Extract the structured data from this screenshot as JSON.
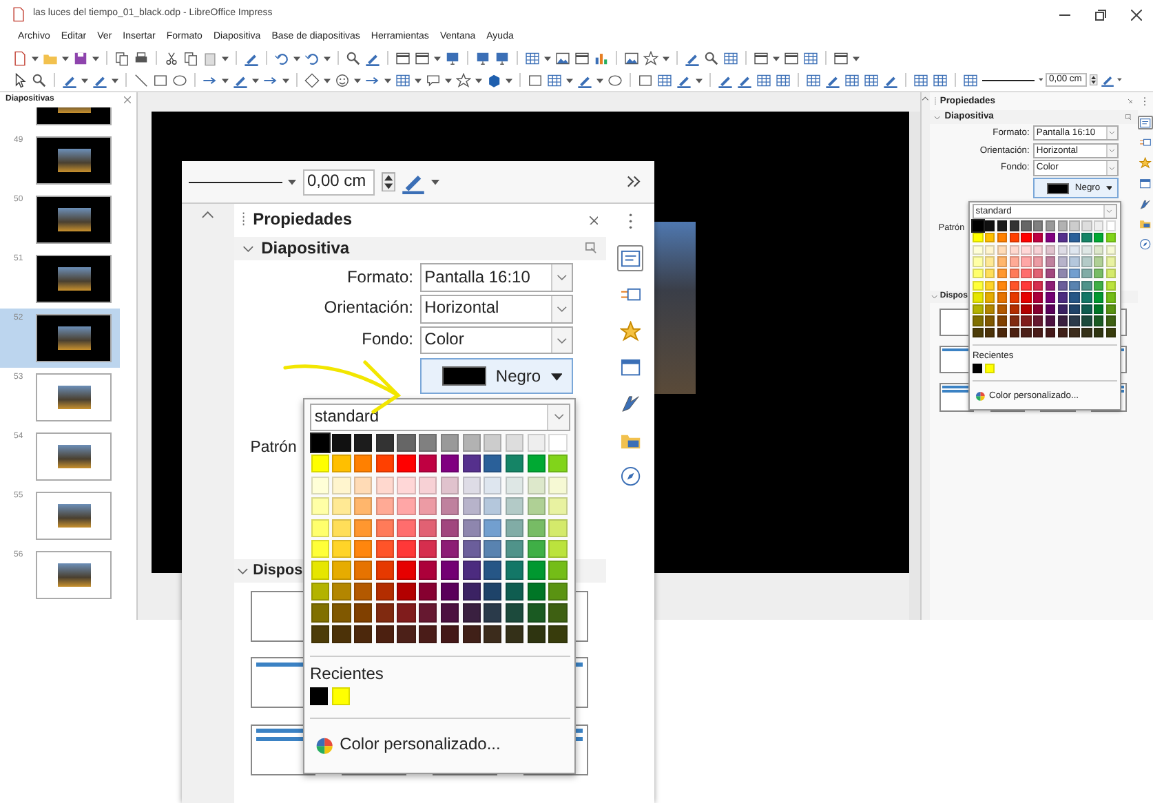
{
  "window": {
    "title": "las luces del tiempo_01_black.odp - LibreOffice Impress"
  },
  "menu": [
    "Archivo",
    "Editar",
    "Ver",
    "Insertar",
    "Formato",
    "Diapositiva",
    "Base de diapositivas",
    "Herramientas",
    "Ventana",
    "Ayuda"
  ],
  "toolbar": {
    "line_width": "0,00 cm"
  },
  "slides_pane": {
    "title": "Diapositivas",
    "slides": [
      {
        "color": "#000000",
        "selected": false
      },
      {
        "number": "49",
        "color": "#000000",
        "selected": false
      },
      {
        "number": "50",
        "color": "#000000",
        "selected": false
      },
      {
        "number": "51",
        "color": "#000000",
        "selected": false
      },
      {
        "number": "52",
        "color": "#000000",
        "selected": true
      },
      {
        "number": "53",
        "color": "#ffffff",
        "selected": false
      },
      {
        "number": "54",
        "color": "#ffffff",
        "selected": false
      },
      {
        "number": "55",
        "color": "#ffffff",
        "selected": false
      },
      {
        "number": "56",
        "color": "#ffffff",
        "selected": false
      }
    ]
  },
  "palette": [
    {
      "swatches": [
        {
          "color": "#000000",
          "selected": true
        },
        {
          "color": "#111111",
          "selected": false
        },
        {
          "color": "#1c1c1c",
          "selected": false
        },
        {
          "color": "#333333",
          "selected": false
        },
        {
          "color": "#666666",
          "selected": false
        },
        {
          "color": "#808080",
          "selected": false
        },
        {
          "color": "#999999",
          "selected": false
        },
        {
          "color": "#b2b2b2",
          "selected": false
        },
        {
          "color": "#cccccc",
          "selected": false
        },
        {
          "color": "#dddddd",
          "selected": false
        },
        {
          "color": "#eeeeee",
          "selected": false
        },
        {
          "color": "#ffffff",
          "selected": false
        }
      ]
    },
    {
      "swatches": [
        {
          "color": "#ffff00",
          "selected": false
        },
        {
          "color": "#ffbf00",
          "selected": false
        },
        {
          "color": "#ff8000",
          "selected": false
        },
        {
          "color": "#ff4000",
          "selected": false
        },
        {
          "color": "#ff0000",
          "selected": false
        },
        {
          "color": "#bf0041",
          "selected": false
        },
        {
          "color": "#800080",
          "selected": false
        },
        {
          "color": "#55308d",
          "selected": false
        },
        {
          "color": "#2a6099",
          "selected": false
        },
        {
          "color": "#158466",
          "selected": false
        },
        {
          "color": "#00a933",
          "selected": false
        },
        {
          "color": "#81d41a",
          "selected": false
        }
      ]
    },
    {
      "swatches": [
        {
          "color": "#ffffd7",
          "selected": false
        },
        {
          "color": "#fff5ce",
          "selected": false
        },
        {
          "color": "#ffdbb6",
          "selected": false
        },
        {
          "color": "#ffd8ce",
          "selected": false
        },
        {
          "color": "#ffd7d7",
          "selected": false
        },
        {
          "color": "#f7d1d5",
          "selected": false
        },
        {
          "color": "#e0c2cd",
          "selected": false
        },
        {
          "color": "#dedce6",
          "selected": false
        },
        {
          "color": "#dee6ef",
          "selected": false
        },
        {
          "color": "#dee7e5",
          "selected": false
        },
        {
          "color": "#dde8cb",
          "selected": false
        },
        {
          "color": "#f6f9d4",
          "selected": false
        }
      ]
    },
    {
      "swatches": [
        {
          "color": "#ffffa6",
          "selected": false
        },
        {
          "color": "#ffe994",
          "selected": false
        },
        {
          "color": "#ffb66c",
          "selected": false
        },
        {
          "color": "#ffaa95",
          "selected": false
        },
        {
          "color": "#ffa6a6",
          "selected": false
        },
        {
          "color": "#ec9ba4",
          "selected": false
        },
        {
          "color": "#bf819e",
          "selected": false
        },
        {
          "color": "#b7b3ca",
          "selected": false
        },
        {
          "color": "#b4c7dc",
          "selected": false
        },
        {
          "color": "#b3cac7",
          "selected": false
        },
        {
          "color": "#afd095",
          "selected": false
        },
        {
          "color": "#e8f2a1",
          "selected": false
        }
      ]
    },
    {
      "swatches": [
        {
          "color": "#ffff6d",
          "selected": false
        },
        {
          "color": "#ffde59",
          "selected": false
        },
        {
          "color": "#ff972f",
          "selected": false
        },
        {
          "color": "#ff7b59",
          "selected": false
        },
        {
          "color": "#ff6d6d",
          "selected": false
        },
        {
          "color": "#e16173",
          "selected": false
        },
        {
          "color": "#a1467e",
          "selected": false
        },
        {
          "color": "#8e86ae",
          "selected": false
        },
        {
          "color": "#729fcf",
          "selected": false
        },
        {
          "color": "#81aca6",
          "selected": false
        },
        {
          "color": "#77bc65",
          "selected": false
        },
        {
          "color": "#d4ea6b",
          "selected": false
        }
      ]
    },
    {
      "swatches": [
        {
          "color": "#ffff38",
          "selected": false
        },
        {
          "color": "#ffd428",
          "selected": false
        },
        {
          "color": "#ff860d",
          "selected": false
        },
        {
          "color": "#ff5429",
          "selected": false
        },
        {
          "color": "#ff3838",
          "selected": false
        },
        {
          "color": "#d62e4e",
          "selected": false
        },
        {
          "color": "#8d1d75",
          "selected": false
        },
        {
          "color": "#6b5e9b",
          "selected": false
        },
        {
          "color": "#5983b0",
          "selected": false
        },
        {
          "color": "#50938a",
          "selected": false
        },
        {
          "color": "#3faf46",
          "selected": false
        },
        {
          "color": "#bbe33d",
          "selected": false
        }
      ]
    },
    {
      "swatches": [
        {
          "color": "#e6e600",
          "selected": false
        },
        {
          "color": "#e6ac00",
          "selected": false
        },
        {
          "color": "#e67300",
          "selected": false
        },
        {
          "color": "#e63900",
          "selected": false
        },
        {
          "color": "#e60000",
          "selected": false
        },
        {
          "color": "#ac003a",
          "selected": false
        },
        {
          "color": "#730073",
          "selected": false
        },
        {
          "color": "#4c2b7f",
          "selected": false
        },
        {
          "color": "#265686",
          "selected": false
        },
        {
          "color": "#137767",
          "selected": false
        },
        {
          "color": "#009830",
          "selected": false
        },
        {
          "color": "#74bd17",
          "selected": false
        }
      ]
    },
    {
      "swatches": [
        {
          "color": "#b3b300",
          "selected": false
        },
        {
          "color": "#b38600",
          "selected": false
        },
        {
          "color": "#b35900",
          "selected": false
        },
        {
          "color": "#b32d00",
          "selected": false
        },
        {
          "color": "#b30000",
          "selected": false
        },
        {
          "color": "#860030",
          "selected": false
        },
        {
          "color": "#5a005a",
          "selected": false
        },
        {
          "color": "#3b2263",
          "selected": false
        },
        {
          "color": "#1e4369",
          "selected": false
        },
        {
          "color": "#0f5d50",
          "selected": false
        },
        {
          "color": "#007626",
          "selected": false
        },
        {
          "color": "#5a9312",
          "selected": false
        }
      ]
    },
    {
      "swatches": [
        {
          "color": "#807000",
          "selected": false
        },
        {
          "color": "#805800",
          "selected": false
        },
        {
          "color": "#804000",
          "selected": false
        },
        {
          "color": "#802a10",
          "selected": false
        },
        {
          "color": "#801c1c",
          "selected": false
        },
        {
          "color": "#661830",
          "selected": false
        },
        {
          "color": "#4c1040",
          "selected": false
        },
        {
          "color": "#3a2040",
          "selected": false
        },
        {
          "color": "#2a3a4a",
          "selected": false
        },
        {
          "color": "#1c4a3c",
          "selected": false
        },
        {
          "color": "#1a5a22",
          "selected": false
        },
        {
          "color": "#3e6012",
          "selected": false
        }
      ]
    },
    {
      "swatches": [
        {
          "color": "#4c3c08",
          "selected": false
        },
        {
          "color": "#4c3208",
          "selected": false
        },
        {
          "color": "#4c280c",
          "selected": false
        },
        {
          "color": "#4c2010",
          "selected": false
        },
        {
          "color": "#4c2018",
          "selected": false
        },
        {
          "color": "#4a1c18",
          "selected": false
        },
        {
          "color": "#441818",
          "selected": false
        },
        {
          "color": "#402018",
          "selected": false
        },
        {
          "color": "#3c2c1c",
          "selected": false
        },
        {
          "color": "#343018",
          "selected": false
        },
        {
          "color": "#2e3410",
          "selected": false
        },
        {
          "color": "#383c0c",
          "selected": false
        }
      ]
    }
  ],
  "sidebar": {
    "title": "Propiedades",
    "section": "Diapositiva",
    "fields": [
      {
        "label": "Formato:",
        "value": "Pantalla 16:10"
      },
      {
        "label": "Orientación:",
        "value": "Horizontal"
      },
      {
        "label": "Fondo:",
        "value": "Color"
      }
    ],
    "color_button": {
      "color": "#000000",
      "label": "Negro"
    },
    "pattern_label": "Patrón",
    "layouts_title": "Dispos",
    "popup": {
      "palette": "standard",
      "recent_title": "Recientes",
      "recent": [
        {
          "color": "#000000"
        },
        {
          "color": "#ffff00"
        }
      ],
      "custom": "Color personalizado..."
    },
    "deck_tabs": [
      {
        "kind": "properties",
        "selected": true
      },
      {
        "kind": "transition",
        "selected": false
      },
      {
        "kind": "animation",
        "selected": false
      },
      {
        "kind": "master",
        "selected": false
      },
      {
        "kind": "styles",
        "selected": false
      },
      {
        "kind": "gallery",
        "selected": false
      },
      {
        "kind": "navigator",
        "selected": false
      }
    ]
  },
  "zoomed_inset": {
    "line_width": "0,00 cm",
    "title": "Propiedades",
    "section": "Diapositiva",
    "fields": [
      {
        "label": "Formato:",
        "value": "Pantalla 16:10"
      },
      {
        "label": "Orientación:",
        "value": "Horizontal"
      },
      {
        "label": "Fondo:",
        "value": "Color"
      }
    ],
    "color_button": {
      "color": "#000000",
      "label": "Negro"
    },
    "pattern_label": "Patrón",
    "layouts_title": "Dispos",
    "popup": {
      "palette": "standard",
      "recent_title": "Recientes",
      "recent": [
        {
          "color": "#000000"
        },
        {
          "color": "#ffff00"
        }
      ],
      "custom": "Color personalizado..."
    },
    "deck_tabs": [
      {
        "kind": "properties",
        "selected": true
      },
      {
        "kind": "transition",
        "selected": false
      },
      {
        "kind": "animation",
        "selected": false
      },
      {
        "kind": "master",
        "selected": false
      },
      {
        "kind": "styles",
        "selected": false
      },
      {
        "kind": "gallery",
        "selected": false
      },
      {
        "kind": "navigator",
        "selected": false
      }
    ]
  }
}
